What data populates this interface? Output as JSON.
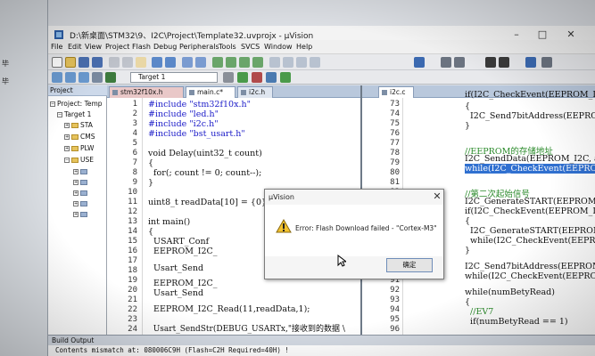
{
  "window": {
    "title": "D:\\新桌面\\STM32\\9、I2C\\Project\\Template32.uvprojx - µVision"
  },
  "desktop": {
    "chars": [
      "毕",
      "毕"
    ]
  },
  "menubar": [
    "File",
    "Edit",
    "View",
    "Project",
    "Flash",
    "Debug",
    "Peripherals",
    "Tools",
    "SVCS",
    "Window",
    "Help"
  ],
  "toolbar": {
    "target_name": "Target 1"
  },
  "project_panel": {
    "header": "Project",
    "tree": [
      {
        "label": "Project: Temp",
        "box": "−"
      },
      {
        "label": "Target 1",
        "box": "−"
      },
      {
        "label": "STA",
        "box": "+"
      },
      {
        "label": "CMS",
        "box": "+"
      },
      {
        "label": "PLW",
        "box": "+"
      },
      {
        "label": "USE",
        "box": "−"
      },
      {
        "label": "",
        "box": "+"
      },
      {
        "label": "",
        "box": "+"
      },
      {
        "label": "",
        "box": "+"
      },
      {
        "label": "",
        "box": "+"
      },
      {
        "label": "",
        "box": "+"
      }
    ]
  },
  "editor_left": {
    "tabs": [
      "stm32f10x.h",
      "main.c*",
      "i2c.h"
    ],
    "line_numbers": [
      "1",
      "2",
      "3",
      "4",
      "5",
      "6",
      "7",
      "8",
      "9",
      "10",
      "11",
      "12",
      "13",
      "14",
      "15",
      "16",
      "17",
      "18",
      "19",
      "20",
      "21",
      "22",
      "23",
      "24"
    ],
    "lines": [
      "#include \"stm32f10x.h\"",
      "#include \"led.h\"",
      "#include \"i2c.h\"",
      "#include \"bst_usart.h\"",
      "void Delay(uint32_t count)",
      "{",
      "  for(; count != 0; count--);",
      "}",
      "uint8_t readData[10] = {0};",
      "int main()",
      "{",
      "  USART_Conf",
      "  EEPROM_I2C_",
      "  Usart_Send",
      "  EEPROM_I2C_",
      "  Usart_Send",
      "  EEPROM_I2C_Read(11,readData,1);",
      "  Usart_SendStr(DEBUG_USARTx,\"接收到的数据 \\"
    ]
  },
  "editor_right": {
    "tabs": [
      "i2c.c"
    ],
    "line_numbers": [
      "73",
      "74",
      "75",
      "76",
      "77",
      "78",
      "79",
      "80",
      "81",
      "82",
      "83",
      "84",
      "85",
      "86",
      "87",
      "88",
      "89",
      "90",
      "91",
      "92",
      "93",
      "94",
      "95",
      "96",
      "97",
      "98"
    ],
    "lines": [
      "if(I2C_CheckEvent(EEPROM_I2C, I",
      "{",
      "  I2C_Send7bitAddress(EEPROM_I2C",
      "}",
      "//EEPROM的存储地址",
      "I2C_SendData(EEPROM_I2C, addr);",
      "while(I2C_CheckEvent(EEPROM_I2C",
      "//第二次起始信号",
      "I2C_GenerateSTART(EEPROM_I2C, E",
      "if(I2C_CheckEvent(EEPROM_I2C, I",
      "{",
      "  I2C_GenerateSTART(EEPROM_I2C,",
      "  while(I2C_CheckEvent(EEPROM_I2",
      "}",
      "I2C_Send7bitAddress(EEPROM_I2C",
      "while(I2C_CheckEvent(EEPROM_I2C",
      "while(numBetyRead)",
      "{",
      "  //EV7",
      "  if(numBetyRead == 1)"
    ]
  },
  "dialog": {
    "title": "µVision",
    "message": "Error: Flash Download failed  -  \"Cortex-M3\"",
    "ok_label": "确定",
    "close_glyph": "✕"
  },
  "build_output": {
    "header": "Build Output",
    "text": "Contents mismatch at: 080006C9H  (Flash=C2H  Required=40H) !"
  }
}
